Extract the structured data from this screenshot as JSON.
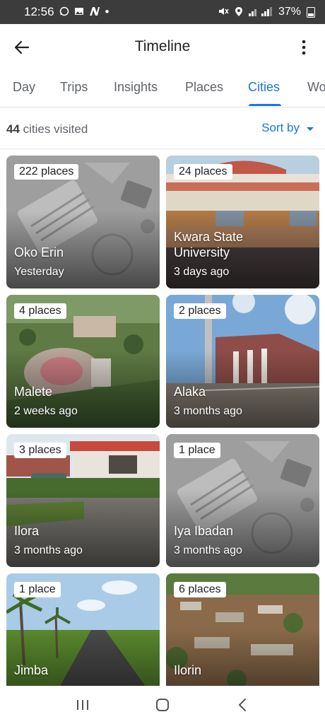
{
  "status_bar": {
    "time": "12:56",
    "battery": "37%",
    "dot": "•"
  },
  "app_bar": {
    "title": "Timeline"
  },
  "tabs": [
    {
      "label": "Day"
    },
    {
      "label": "Trips"
    },
    {
      "label": "Insights"
    },
    {
      "label": "Places"
    },
    {
      "label": "Cities",
      "active": true
    },
    {
      "label": "Wo"
    }
  ],
  "summary": {
    "count": "44",
    "count_suffix": " cities visited",
    "sort_label": "Sort by"
  },
  "cities": [
    {
      "badge": "222 places",
      "name": "Oko Erin",
      "time": "Yesterday",
      "image": "placeholder"
    },
    {
      "badge": "24 places",
      "name_line1": "Kwara State",
      "name_line2": "University",
      "time": "3 days ago",
      "image": "building"
    },
    {
      "badge": "4 places",
      "name": "Malete",
      "time": "2 weeks ago",
      "image": "aerial-campus"
    },
    {
      "badge": "2 places",
      "name": "Alaka",
      "time": "3 months ago",
      "image": "brick-building"
    },
    {
      "badge": "3 places",
      "name": "Ilora",
      "time": "3 months ago",
      "image": "compound"
    },
    {
      "badge": "1 place",
      "name": "Iya Ibadan",
      "time": "3 months ago",
      "image": "placeholder"
    },
    {
      "badge": "1 place",
      "name": "Jimba",
      "time": "",
      "image": "road-palms"
    },
    {
      "badge": "6 places",
      "name": "Ilorin",
      "time": "",
      "image": "aerial-town"
    }
  ],
  "colors": {
    "accent": "#1a73e8",
    "status_bar": "#3c3c3c"
  }
}
